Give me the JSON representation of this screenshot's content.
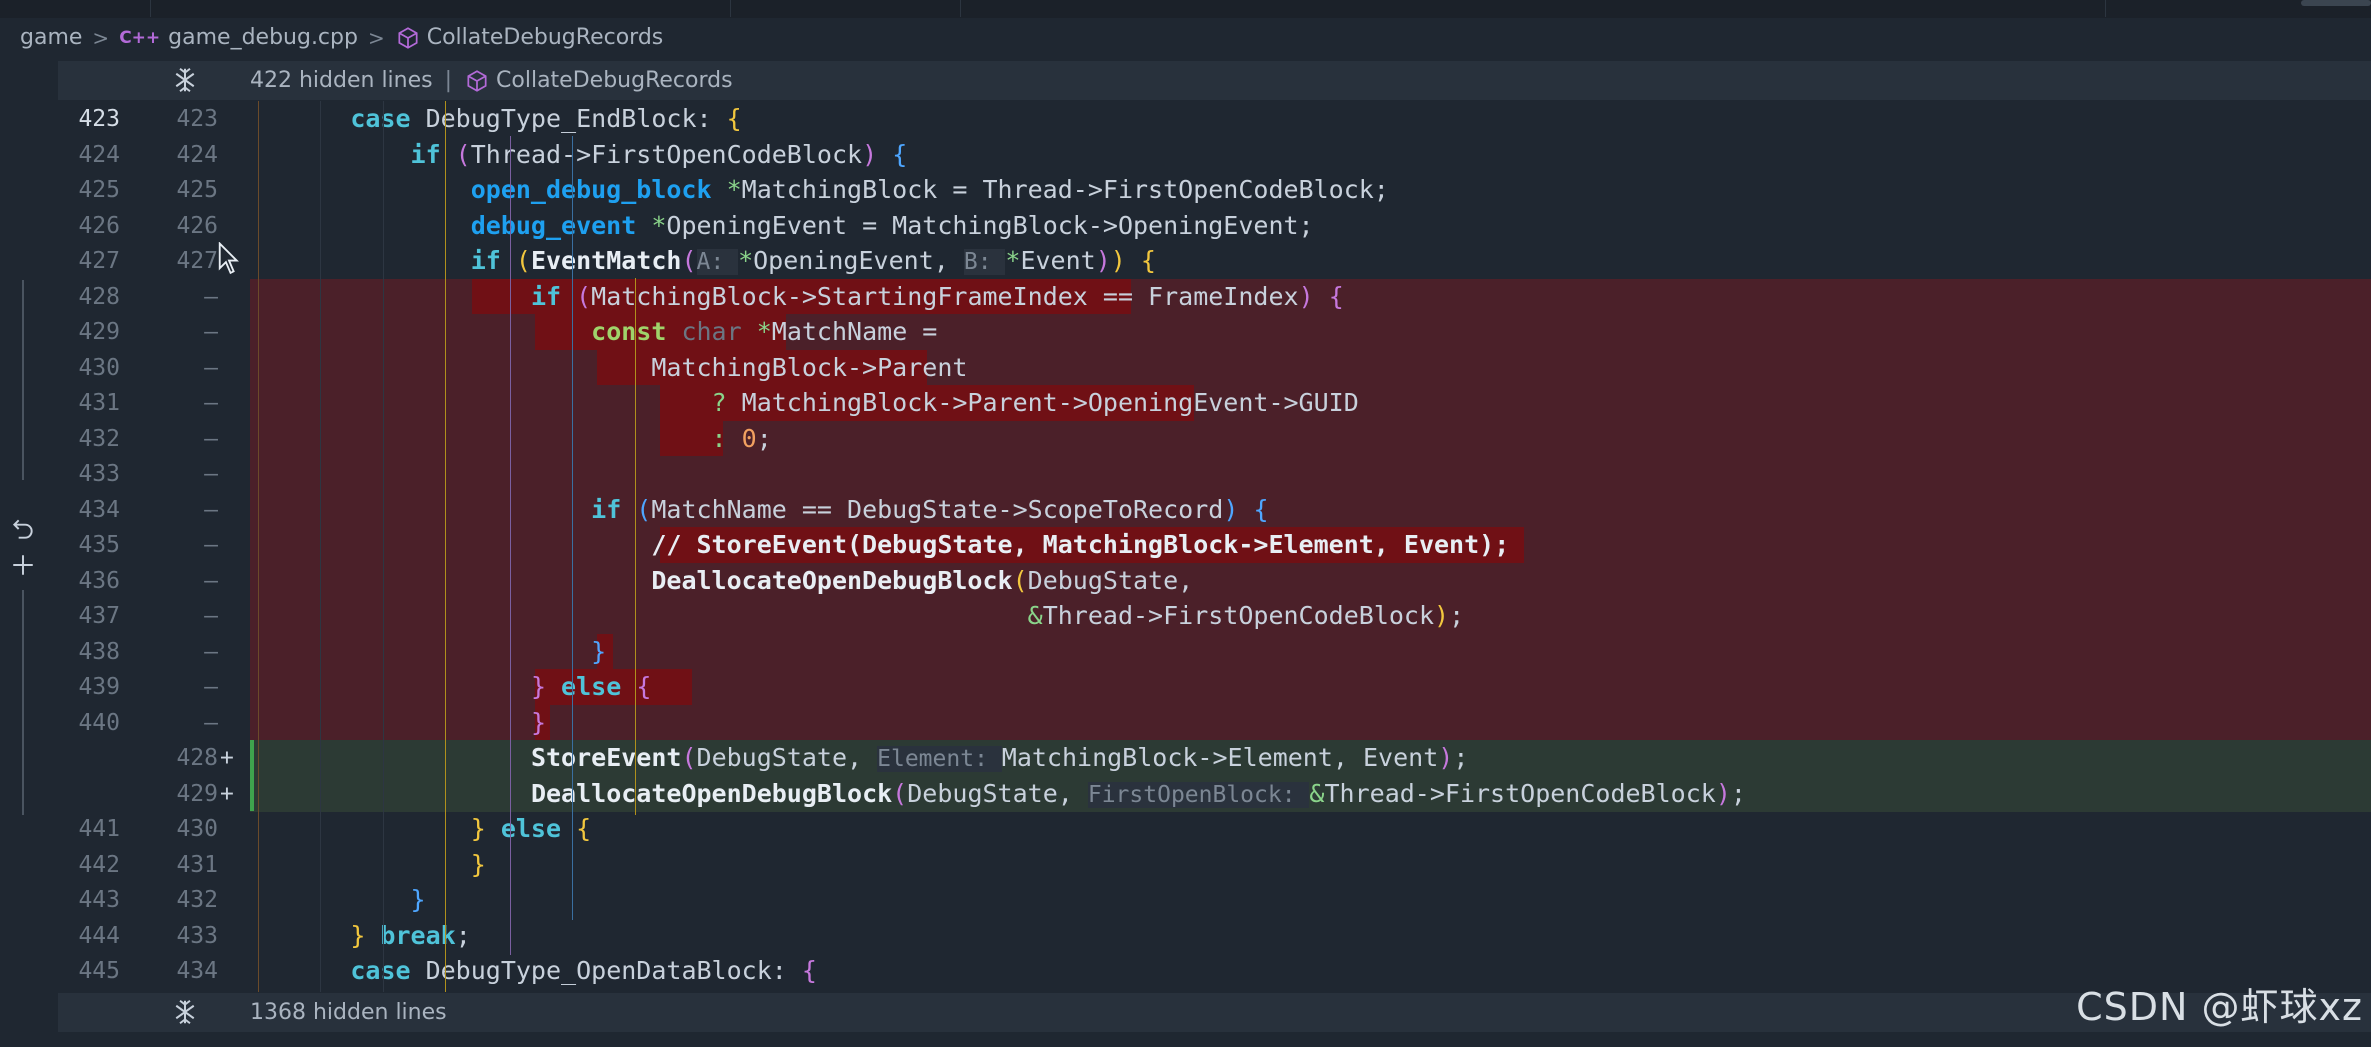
{
  "breadcrumb": {
    "folder": "game",
    "lang_badge": "C++",
    "file": "game_debug.cpp",
    "symbol": "CollateDebugRecords"
  },
  "fold_top": {
    "text": "422 hidden lines",
    "symbol": "CollateDebugRecords"
  },
  "fold_bottom": {
    "text": "1368 hidden lines"
  },
  "watermark": "CSDN @虾球xz",
  "colors": {
    "keyword": "#4fc3d9",
    "type": "#1ea0f0",
    "bracket_yellow": "#f2c73e",
    "bracket_pink": "#c678dd",
    "bracket_blue": "#4ea6ff",
    "function": "#e8eef4",
    "inlay_hint": "#7c8794",
    "deleted_bg": "#4b2029",
    "deleted_highlight": "#701015",
    "added_bg": "#2c3a34",
    "added_bar": "#3fa34d",
    "number": "#f2a060"
  },
  "icons": [
    "cube-icon",
    "unfold-icon",
    "undo-icon",
    "plus-icon",
    "mouse-cursor-icon"
  ],
  "lines": [
    {
      "a": "423",
      "b": "423",
      "mark": "",
      "kind": "ctx",
      "tokens": [
        [
          "ind",
          "      "
        ],
        [
          "kw",
          "case "
        ],
        [
          "p",
          "DebugType_EndBlock: "
        ],
        [
          "by",
          "{"
        ]
      ]
    },
    {
      "a": "424",
      "b": "424",
      "mark": "",
      "kind": "ctx",
      "tokens": [
        [
          "ind",
          "          "
        ],
        [
          "kw",
          "if "
        ],
        [
          "bp",
          "("
        ],
        [
          "p",
          "Thread->FirstOpenCodeBlock"
        ],
        [
          "bp",
          ")"
        ],
        [
          "p",
          " "
        ],
        [
          "bb",
          "{"
        ]
      ]
    },
    {
      "a": "425",
      "b": "425",
      "mark": "",
      "kind": "ctx",
      "tokens": [
        [
          "ind",
          "              "
        ],
        [
          "ty",
          "open_debug_block "
        ],
        [
          "op",
          "*"
        ],
        [
          "p",
          "MatchingBlock = Thread->FirstOpenCodeBlock;"
        ]
      ]
    },
    {
      "a": "426",
      "b": "426",
      "mark": "",
      "kind": "ctx",
      "tokens": [
        [
          "ind",
          "              "
        ],
        [
          "ty",
          "debug_event "
        ],
        [
          "op",
          "*"
        ],
        [
          "p",
          "OpeningEvent = MatchingBlock->OpeningEvent;"
        ]
      ]
    },
    {
      "a": "427",
      "b": "427",
      "mark": "",
      "kind": "ctx",
      "tokens": [
        [
          "ind",
          "              "
        ],
        [
          "kw",
          "if "
        ],
        [
          "by",
          "("
        ],
        [
          "fn",
          "EventMatch"
        ],
        [
          "bp",
          "("
        ],
        [
          "hint",
          "A: "
        ],
        [
          "op",
          "*"
        ],
        [
          "p",
          "OpeningEvent, "
        ],
        [
          "hint",
          "B: "
        ],
        [
          "op",
          "*"
        ],
        [
          "p",
          "Event"
        ],
        [
          "bp",
          ")"
        ],
        [
          "by",
          ")"
        ],
        [
          "p",
          " "
        ],
        [
          "by",
          "{"
        ]
      ]
    },
    {
      "a": "428",
      "b": "—",
      "mark": "",
      "kind": "del",
      "hl": [
        14,
        56
      ],
      "tokens": [
        [
          "ind",
          "                  "
        ],
        [
          "kw",
          "if "
        ],
        [
          "bp",
          "("
        ],
        [
          "p",
          "MatchingBlock->StartingFrameIndex == FrameIndex"
        ],
        [
          "bp",
          ")"
        ],
        [
          "p",
          " "
        ],
        [
          "bp",
          "{"
        ]
      ]
    },
    {
      "a": "429",
      "b": "—",
      "mark": "",
      "kind": "del",
      "hl": [
        18,
        34
      ],
      "tokens": [
        [
          "ind",
          "                      "
        ],
        [
          "kw2",
          "const "
        ],
        [
          "mut",
          "char "
        ],
        [
          "op",
          "*"
        ],
        [
          "p",
          "MatchName ="
        ]
      ]
    },
    {
      "a": "430",
      "b": "—",
      "mark": "",
      "kind": "del",
      "hl": [
        22,
        43
      ],
      "tokens": [
        [
          "ind",
          "                          "
        ],
        [
          "p",
          "MatchingBlock->Parent"
        ]
      ]
    },
    {
      "a": "431",
      "b": "—",
      "mark": "",
      "kind": "del",
      "hl": [
        26,
        60
      ],
      "tokens": [
        [
          "ind",
          "                              "
        ],
        [
          "op",
          "? "
        ],
        [
          "p",
          "MatchingBlock->Parent->OpeningEvent->GUID"
        ]
      ]
    },
    {
      "a": "432",
      "b": "—",
      "mark": "",
      "kind": "del",
      "hl": [
        26,
        30
      ],
      "tokens": [
        [
          "ind",
          "                              "
        ],
        [
          "op",
          ": "
        ],
        [
          "num",
          "0"
        ],
        [
          "p",
          ";"
        ]
      ]
    },
    {
      "a": "433",
      "b": "—",
      "mark": "",
      "kind": "del",
      "tokens": []
    },
    {
      "a": "434",
      "b": "—",
      "mark": "",
      "kind": "del",
      "tokens": [
        [
          "ind",
          "                      "
        ],
        [
          "kw",
          "if "
        ],
        [
          "bb",
          "("
        ],
        [
          "p",
          "MatchName == DebugState->ScopeToRecord"
        ],
        [
          "bb",
          ")"
        ],
        [
          "p",
          " "
        ],
        [
          "bb",
          "{"
        ]
      ]
    },
    {
      "a": "435",
      "b": "—",
      "mark": "",
      "kind": "del",
      "hl": [
        26,
        81
      ],
      "tokens": [
        [
          "ind",
          "                          "
        ],
        [
          "cmt",
          "// StoreEvent(DebugState, MatchingBlock->Element, Event);"
        ]
      ]
    },
    {
      "a": "436",
      "b": "—",
      "mark": "",
      "kind": "del",
      "tokens": [
        [
          "ind",
          "                          "
        ],
        [
          "fn",
          "DeallocateOpenDebugBlock"
        ],
        [
          "by",
          "("
        ],
        [
          "p",
          "DebugState,"
        ]
      ]
    },
    {
      "a": "437",
      "b": "—",
      "mark": "",
      "kind": "del",
      "tokens": [
        [
          "ind",
          "                                                   "
        ],
        [
          "op",
          "&"
        ],
        [
          "p",
          "Thread->FirstOpenCodeBlock"
        ],
        [
          "by",
          ")"
        ],
        [
          "p",
          ";"
        ]
      ]
    },
    {
      "a": "438",
      "b": "—",
      "mark": "",
      "kind": "del",
      "hl": [
        22,
        23
      ],
      "tokens": [
        [
          "ind",
          "                      "
        ],
        [
          "bb",
          "}"
        ]
      ]
    },
    {
      "a": "439",
      "b": "—",
      "mark": "",
      "kind": "del",
      "hl": [
        18,
        28
      ],
      "tokens": [
        [
          "ind",
          "                  "
        ],
        [
          "bp",
          "} "
        ],
        [
          "kw",
          "else "
        ],
        [
          "bp",
          "{"
        ]
      ]
    },
    {
      "a": "440",
      "b": "—",
      "mark": "",
      "kind": "del",
      "hl": [
        18,
        19
      ],
      "tokens": [
        [
          "ind",
          "                  "
        ],
        [
          "bp",
          "}"
        ]
      ]
    },
    {
      "a": "",
      "b": "428",
      "mark": "+",
      "kind": "add",
      "tokens": [
        [
          "ind",
          "                  "
        ],
        [
          "fn",
          "StoreEvent"
        ],
        [
          "bp",
          "("
        ],
        [
          "p",
          "DebugState, "
        ],
        [
          "hint",
          "Element: "
        ],
        [
          "p",
          "MatchingBlock->Element, Event"
        ],
        [
          "bp",
          ")"
        ],
        [
          "p",
          ";"
        ]
      ]
    },
    {
      "a": "",
      "b": "429",
      "mark": "+",
      "kind": "add",
      "tokens": [
        [
          "ind",
          "                  "
        ],
        [
          "fn",
          "DeallocateOpenDebugBlock"
        ],
        [
          "bp",
          "("
        ],
        [
          "p",
          "DebugState, "
        ],
        [
          "hint",
          "FirstOpenBlock: "
        ],
        [
          "op",
          "&"
        ],
        [
          "p",
          "Thread->FirstOpenCodeBlock"
        ],
        [
          "bp",
          ")"
        ],
        [
          "p",
          ";"
        ]
      ]
    },
    {
      "a": "441",
      "b": "430",
      "mark": "",
      "kind": "ctx",
      "tokens": [
        [
          "ind",
          "              "
        ],
        [
          "by",
          "} "
        ],
        [
          "kw",
          "else "
        ],
        [
          "by",
          "{"
        ]
      ]
    },
    {
      "a": "442",
      "b": "431",
      "mark": "",
      "kind": "ctx",
      "tokens": [
        [
          "ind",
          "              "
        ],
        [
          "by",
          "}"
        ]
      ]
    },
    {
      "a": "443",
      "b": "432",
      "mark": "",
      "kind": "ctx",
      "tokens": [
        [
          "ind",
          "          "
        ],
        [
          "bb",
          "}"
        ]
      ]
    },
    {
      "a": "444",
      "b": "433",
      "mark": "",
      "kind": "ctx",
      "tokens": [
        [
          "ind",
          "      "
        ],
        [
          "by",
          "} "
        ],
        [
          "kw",
          "break"
        ],
        [
          "p",
          ";"
        ]
      ]
    },
    {
      "a": "445",
      "b": "434",
      "mark": "",
      "kind": "ctx",
      "tokens": [
        [
          "ind",
          "      "
        ],
        [
          "kw",
          "case "
        ],
        [
          "p",
          "DebugType_OpenDataBlock: "
        ],
        [
          "bp",
          "{"
        ]
      ]
    }
  ]
}
